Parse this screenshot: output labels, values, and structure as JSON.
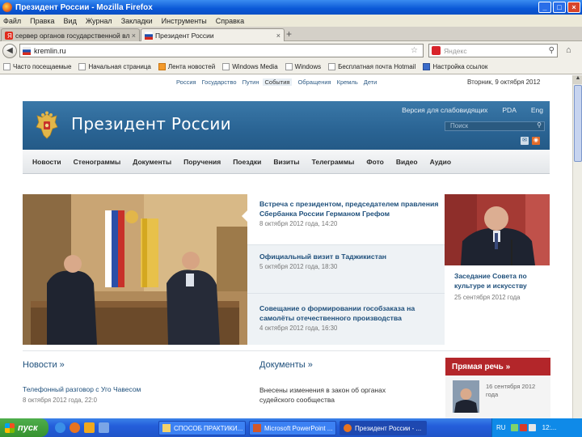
{
  "window": {
    "title": "Президент России - Mozilla Firefox",
    "buttons": {
      "minimize": "_",
      "maximize": "□",
      "close": "×"
    }
  },
  "menu": [
    "Файл",
    "Правка",
    "Вид",
    "Журнал",
    "Закладки",
    "Инструменты",
    "Справка"
  ],
  "tabs": [
    {
      "label": "сервер органов государственной влас...",
      "close": "×",
      "active": false
    },
    {
      "label": "Президент России",
      "close": "×",
      "active": true
    }
  ],
  "new_tab": "+",
  "navbar": {
    "back": "◀",
    "url": "kremlin.ru",
    "star": "☆",
    "search_placeholder": "Яндекс",
    "search_icon": "⚲",
    "home_icon": "⌂"
  },
  "bookmarks": [
    "Часто посещаемые",
    "Начальная страница",
    "Лента новостей",
    "Windows Media",
    "Windows",
    "Бесплатная почта Hotmail",
    "Настройка ссылок"
  ],
  "site": {
    "top_links": [
      "Россия",
      "Государство",
      "Путин",
      "События",
      "Обращения",
      "Кремль",
      "Дети"
    ],
    "top_current_index": 3,
    "date": "Вторник, 9 октября 2012",
    "title": "Президент России",
    "header_links": [
      "Версия для слабовидящих",
      "PDA",
      "Eng"
    ],
    "search_placeholder": "Поиск",
    "main_menu": [
      "Новости",
      "Стенограммы",
      "Документы",
      "Поручения",
      "Поездки",
      "Визиты",
      "Телеграммы",
      "Фото",
      "Видео",
      "Аудио"
    ],
    "hero_items": [
      {
        "title": "Встреча с президентом, председателем правления Сбербанка России Германом Грефом",
        "date": "8 октября 2012 года, 14:20"
      },
      {
        "title": "Официальный визит в Таджикистан",
        "date": "5 октября 2012 года, 18:30"
      },
      {
        "title": "Совещание о формировании гособзаказа на самолёты отечественного производства",
        "date": "4 октября 2012 года, 16:30"
      }
    ],
    "side_item": {
      "title": "Заседание Совета по культуре и искусству",
      "date": "25 сентября 2012 года"
    },
    "news_section": {
      "heading": "Новости »",
      "item_title": "Телефонный разговор с Уго Чавесом",
      "item_date": "8 октября 2012 года, 22:0"
    },
    "docs_section": {
      "heading": "Документы »",
      "item_title": "Внесены изменения в закон об органах судейского сообщества"
    },
    "speech_section": {
      "heading": "Прямая речь »",
      "date": "16 сентября 2012 года"
    }
  },
  "taskbar": {
    "start": "пуск",
    "items": [
      {
        "label": "СПОСОБ ПРАКТИКИ..."
      },
      {
        "label": "Microsoft PowerPoint ..."
      },
      {
        "label": "Президент России - ..."
      }
    ],
    "lang": "RU",
    "clock": "12:..."
  },
  "colors": {
    "header_blue": "#2a6494",
    "link_blue": "#1e4f7b",
    "speech_red": "#b3262a",
    "xp_taskbar": "#245edb"
  }
}
